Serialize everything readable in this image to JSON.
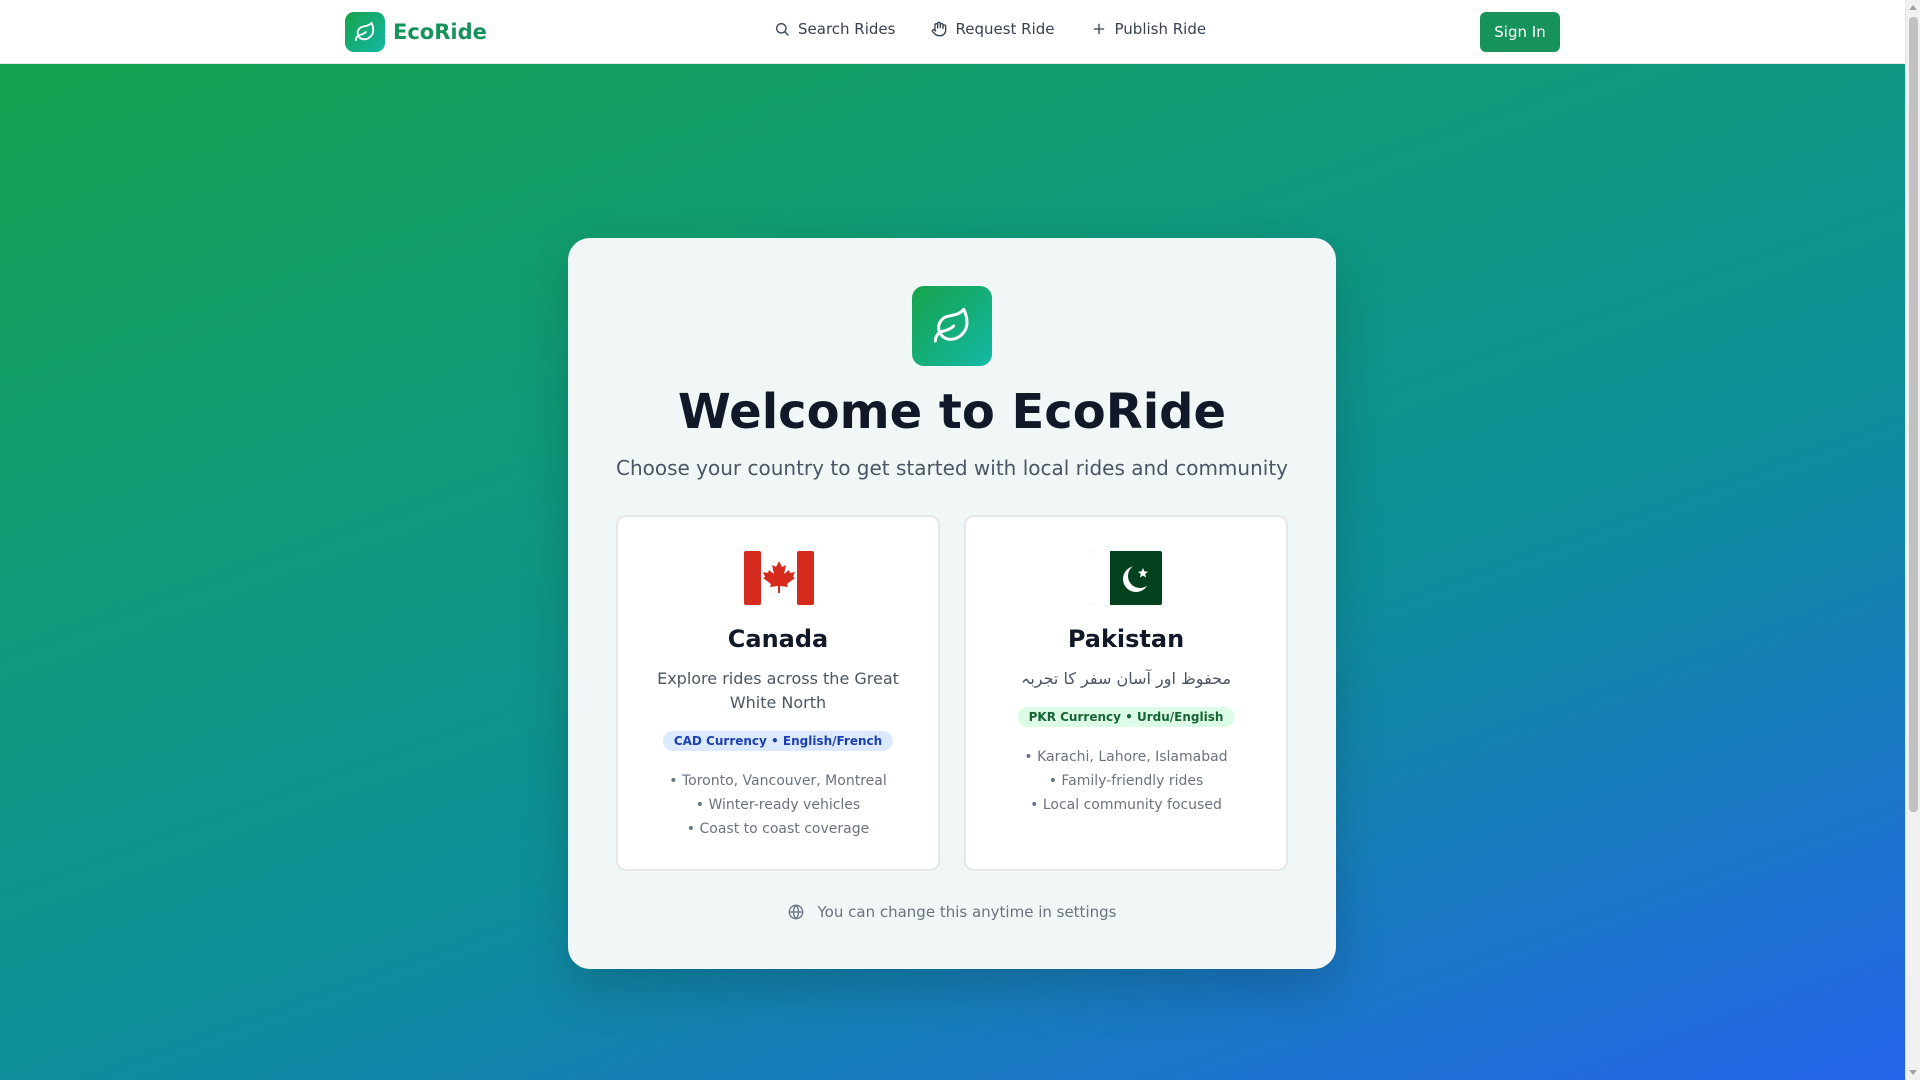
{
  "header": {
    "brand": "EcoRide",
    "nav": [
      {
        "label": "Search Rides",
        "icon": "search-icon"
      },
      {
        "label": "Request Ride",
        "icon": "hand-icon"
      },
      {
        "label": "Publish Ride",
        "icon": "plus-icon"
      }
    ],
    "sign_in_label": "Sign In"
  },
  "main": {
    "title": "Welcome to EcoRide",
    "subtitle": "Choose your country to get started with local rides and community",
    "countries": [
      {
        "name": "Canada",
        "flag": "canada-flag",
        "description": "Explore rides across the Great White North",
        "badge": "CAD Currency • English/French",
        "features": [
          "• Toronto, Vancouver, Montreal",
          "• Winter-ready vehicles",
          "• Coast to coast coverage"
        ]
      },
      {
        "name": "Pakistan",
        "flag": "pakistan-flag",
        "description": "محفوظ اور آسان سفر کا تجربہ",
        "badge": "PKR Currency • Urdu/English",
        "features": [
          "• Karachi, Lahore, Islamabad",
          "• Family-friendly rides",
          "• Local community focused"
        ]
      }
    ],
    "settings_note": "You can change this anytime in settings"
  },
  "colors": {
    "brand_green": "#15935a",
    "gradient_start": "#16a34a",
    "gradient_end": "#2563eb",
    "canada_badge_bg": "#dbeafe",
    "pakistan_badge_bg": "#dcfce7"
  }
}
